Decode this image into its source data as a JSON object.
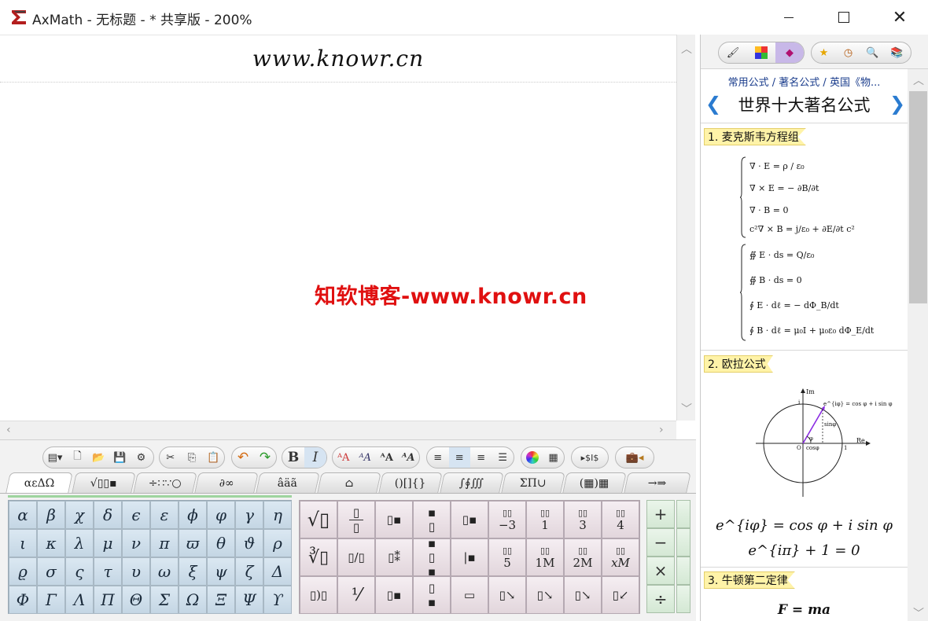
{
  "window": {
    "title": "AxMath - 无标题 - * 共享版 - 200%"
  },
  "editor": {
    "heading": "www.knowr.cn",
    "watermark": "知软博客-www.knowr.cn"
  },
  "toolbar": {
    "bold": "B",
    "italic": "I"
  },
  "tabs": [
    "αεΔΩ",
    "√▯▯▪",
    "÷∷∵○",
    "∂∞",
    "âäã",
    "⌂",
    "()[]{}",
    "∫∮∭",
    "ΣΠ∪",
    "(▦)▦",
    "→⇒"
  ],
  "greek": [
    [
      "α",
      "β",
      "χ",
      "δ",
      "ϵ",
      "ε",
      "ϕ",
      "φ",
      "γ",
      "η"
    ],
    [
      "ι",
      "κ",
      "λ",
      "μ",
      "ν",
      "π",
      "ϖ",
      "θ",
      "ϑ",
      "ρ"
    ],
    [
      "ϱ",
      "σ",
      "ς",
      "τ",
      "υ",
      "ω",
      "ξ",
      "ψ",
      "ζ",
      "Δ"
    ],
    [
      "Φ",
      "Γ",
      "Λ",
      "Π",
      "Θ",
      "Σ",
      "Ω",
      "Ξ",
      "Ψ",
      "ϒ"
    ]
  ],
  "template_labels": {
    "t1": "−3",
    "t2": "1",
    "t3": "3",
    "t4": "4",
    "t5": "5",
    "t6": "1M",
    "t7": "2M",
    "t8": "xM"
  },
  "operators": [
    "+",
    "−",
    "×",
    "÷"
  ],
  "right_panel": {
    "breadcrumb": "常用公式 / 著名公式 / 英国《物...",
    "title": "世界十大著名公式",
    "sections": [
      {
        "label": "1. 麦克斯韦方程组"
      },
      {
        "label": "2. 欧拉公式"
      },
      {
        "label": "3. 牛顿第二定律"
      }
    ],
    "maxwell_diff": [
      "∇ · E = ρ / ε₀",
      "∇ × E = − ∂B/∂t",
      "∇ · B = 0",
      "c²∇ × B = j/ε₀ + ∂E/∂t c²"
    ],
    "maxwell_int": [
      "∯ E · ds = Q/ε₀",
      "∯ B · ds = 0",
      "∮ E · dℓ = − dΦ_B/dt",
      "∮ B · dℓ = μ₀I + μ₀ε₀ dΦ_E/dt"
    ],
    "euler_diagram": {
      "im": "Im",
      "re": "Re",
      "eq": "e^{iφ} = cos φ + i sin φ",
      "sin": "sinφ",
      "cos": "cosφ",
      "phi": "φ",
      "one": "1",
      "origin": "O",
      "top": "i"
    },
    "euler_1": "e^{iφ} = cos φ + i sin φ",
    "euler_2": "e^{iπ} + 1 = 0",
    "newton": "F = ma"
  },
  "colors": {
    "accent": "#2a7bd0",
    "watermark": "#e01010",
    "section_bg": "#fff3a8"
  }
}
